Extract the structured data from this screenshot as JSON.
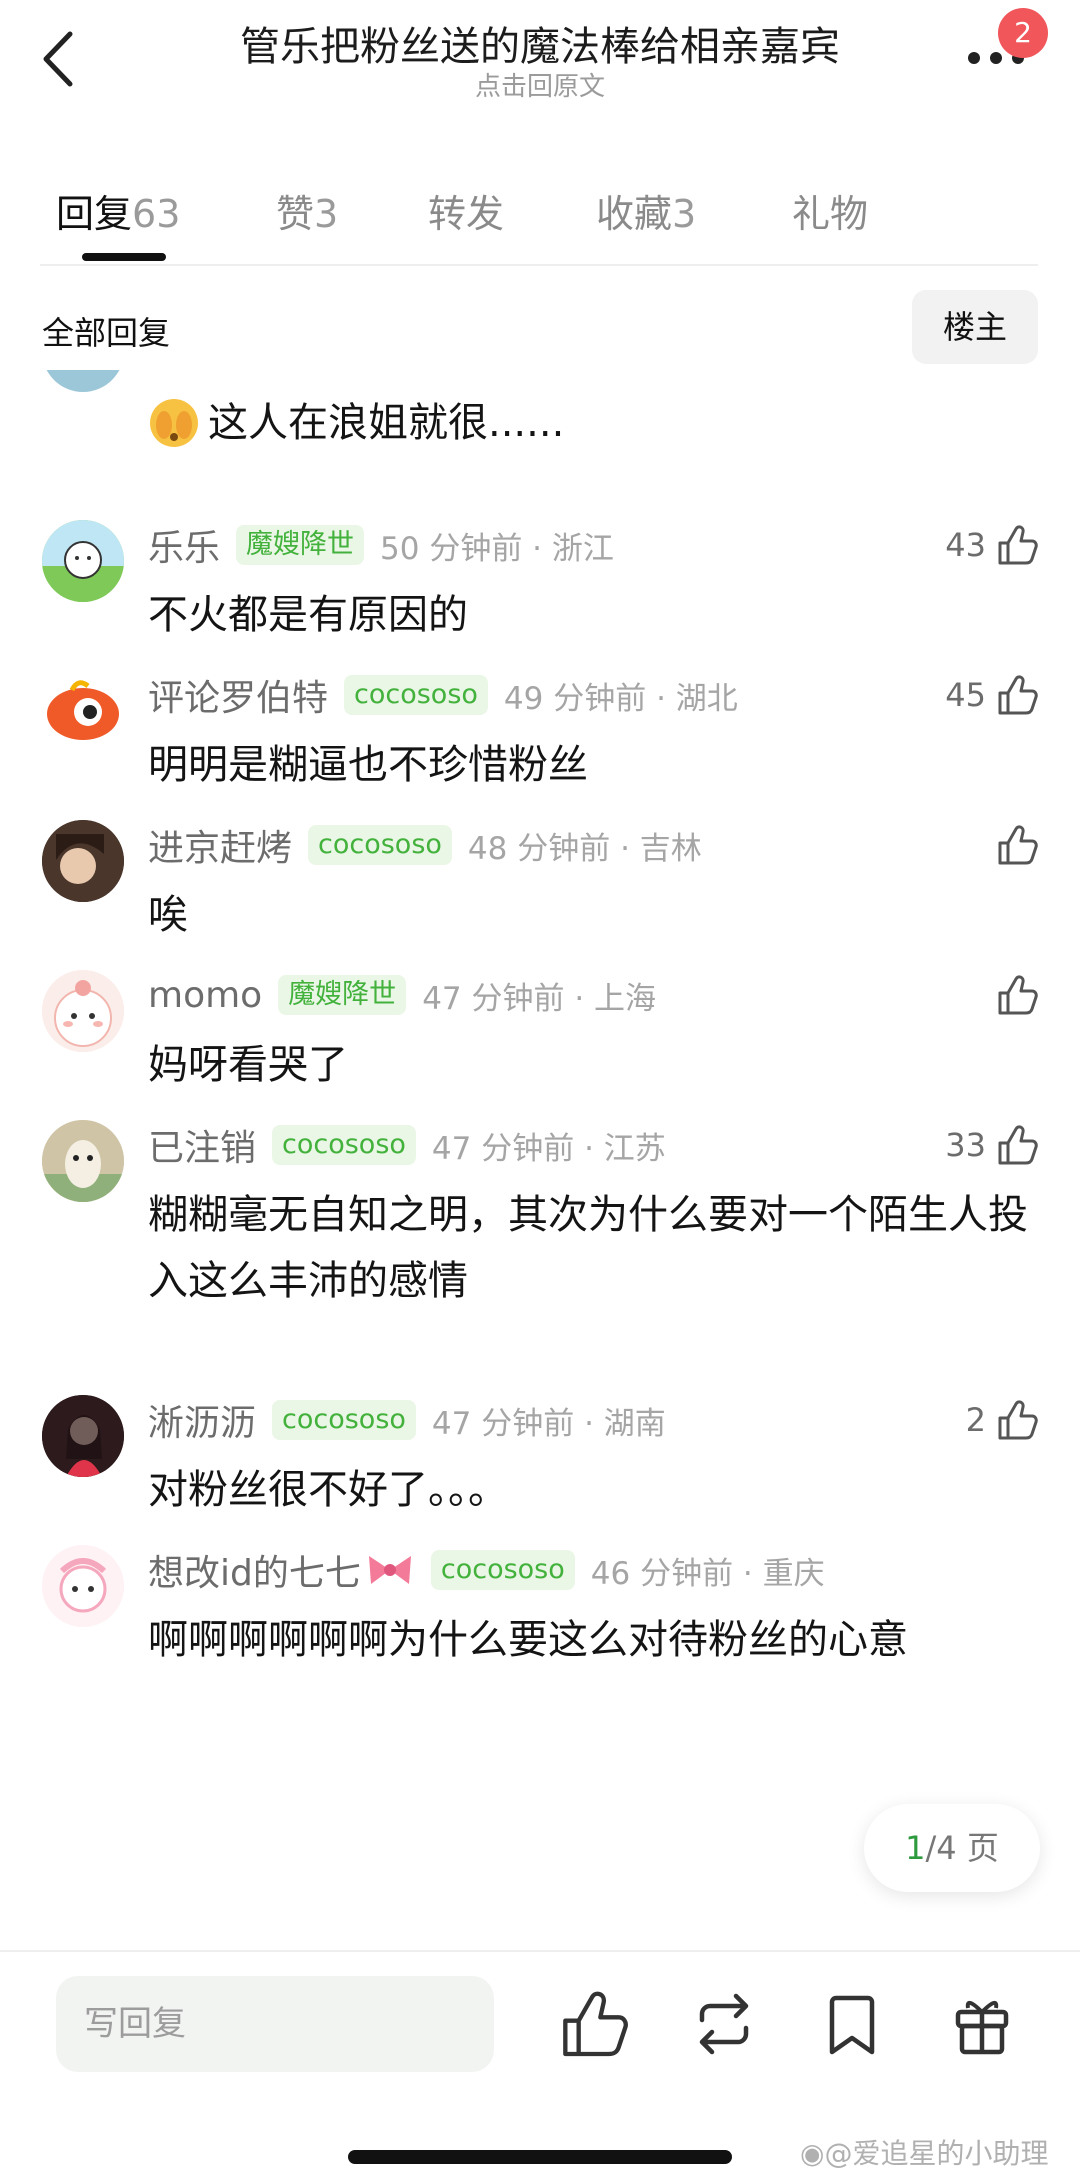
{
  "header": {
    "title": "管乐把粉丝送的魔法棒给相亲嘉宾",
    "subtitle": "点击回原文",
    "notification_count": "2"
  },
  "tabs": [
    {
      "label": "回复",
      "count": "63"
    },
    {
      "label": "赞",
      "count": "3"
    },
    {
      "label": "转发",
      "count": ""
    },
    {
      "label": "收藏",
      "count": "3"
    },
    {
      "label": "礼物",
      "count": ""
    }
  ],
  "filter": {
    "all_replies": "全部回复",
    "owner_button": "楼主"
  },
  "partial_comment": {
    "text": "这人在浪姐就很......"
  },
  "comments": [
    {
      "username": "乐乐",
      "tag": "魔嫂降世",
      "time": "50 分钟前 · 浙江",
      "likes": "43",
      "text": "不火都是有原因的"
    },
    {
      "username": "评论罗伯特",
      "tag": "cocososo",
      "time": "49 分钟前 · 湖北",
      "likes": "45",
      "text": "明明是糊逼也不珍惜粉丝"
    },
    {
      "username": "进京赶烤",
      "tag": "cocososo",
      "time": "48 分钟前 · 吉林",
      "likes": "",
      "text": "唉"
    },
    {
      "username": "momo",
      "tag": "魔嫂降世",
      "time": "47 分钟前 · 上海",
      "likes": "",
      "text": "妈呀看哭了"
    },
    {
      "username": "已注销",
      "tag": "cocososo",
      "time": "47 分钟前 · 江苏",
      "likes": "33",
      "text": "糊糊毫无自知之明，其次为什么要对一个陌生人投入这么丰沛的感情"
    },
    {
      "username": "淅沥沥",
      "tag": "cocososo",
      "time": "47 分钟前 · 湖南",
      "likes": "2",
      "text": "对粉丝很不好了。。。"
    },
    {
      "username": "想改id的七七",
      "tag": "cocososo",
      "time": "46 分钟前 · 重庆",
      "likes": "",
      "text": "啊啊啊啊啊啊为什么要这么对待粉丝的心意"
    }
  ],
  "pagination": {
    "current": "1",
    "rest": "/4 页"
  },
  "bottom_bar": {
    "reply_placeholder": "写回复"
  },
  "watermark": "@爱追星的小助理",
  "icons": [
    "back-icon",
    "more-icon",
    "thumbs-up-icon",
    "repost-icon",
    "bookmark-icon",
    "gift-icon",
    "weibo-logo-icon",
    "bow-emoji-icon",
    "shy-emoji-icon"
  ],
  "colors": {
    "tag_green": "#43b23c",
    "tag_bg": "#eaf6e6",
    "badge_red": "#f0565a",
    "page_current": "#2e9a3e"
  }
}
